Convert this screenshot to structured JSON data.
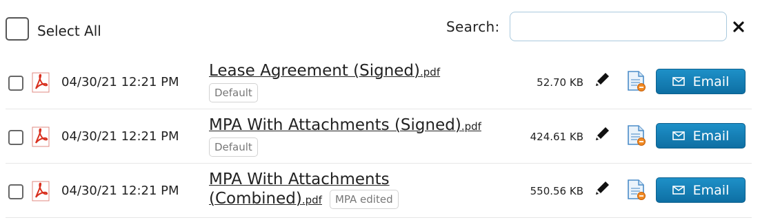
{
  "header": {
    "select_all_label": "Select All",
    "search_label": "Search:",
    "search_value": "",
    "search_placeholder": ""
  },
  "files": [
    {
      "date": "04/30/21 12:21 PM",
      "name": "Lease Agreement (Signed)",
      "ext": ".pdf",
      "tag": "Default",
      "size": "52.70 KB",
      "email_label": "Email"
    },
    {
      "date": "04/30/21 12:21 PM",
      "name": "MPA With Attachments (Signed)",
      "ext": ".pdf",
      "tag": "Default",
      "size": "424.61 KB",
      "email_label": "Email"
    },
    {
      "date": "04/30/21 12:21 PM",
      "name": "MPA With Attachments (Combined)",
      "ext": ".pdf",
      "tag": "MPA edited",
      "size": "550.56 KB",
      "email_label": "Email"
    }
  ],
  "icons": {
    "file_type": "pdf-icon",
    "edit": "pencil-icon",
    "document": "document-icon",
    "email": "envelope-icon",
    "clear": "close-icon"
  },
  "colors": {
    "email_button": "#1681b9",
    "pdf_red": "#d9301f",
    "search_border": "#a9c9dd"
  }
}
